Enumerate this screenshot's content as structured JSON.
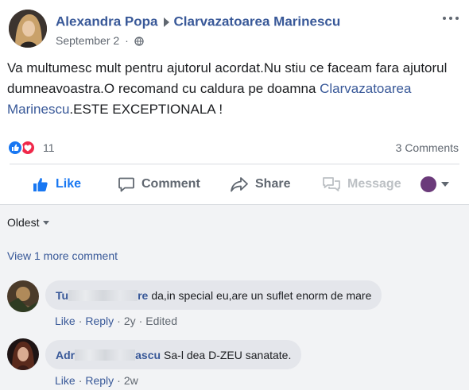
{
  "post": {
    "author": "Alexandra Popa",
    "target_page": "Clarvazatoarea Marinescu",
    "date": "September 2",
    "separator": "·",
    "text_before": "Va multumesc mult pentru ajutorul acordat.Nu stiu ce faceam fara ajutorul dumneavoastra.O recomand cu caldura pe doamna ",
    "text_mention": "Clarvazatoarea Marinescu",
    "text_after": ".ESTE EXCEPTIONALA !",
    "icons": {
      "more": "more-dots-icon",
      "audience": "globe-icon"
    }
  },
  "reactions": {
    "count": "11",
    "types": [
      "like",
      "love"
    ],
    "comments_label": "3 Comments"
  },
  "actions": {
    "like": "Like",
    "comment": "Comment",
    "share": "Share",
    "message": "Message"
  },
  "comments_section": {
    "sort_label": "Oldest",
    "view_more": "View 1 more comment",
    "comments": [
      {
        "name_start": "Tu",
        "name_end": "re",
        "text": "da,in special eu,are un suflet enorm de mare",
        "like": "Like",
        "reply": "Reply",
        "time": "2y",
        "edited": "Edited",
        "sep": "·"
      },
      {
        "name_start": "Adr",
        "name_end": "ascu",
        "text": "Sa-l dea D-ZEU sanatate.",
        "like": "Like",
        "reply": "Reply",
        "time": "2w",
        "sep": "·"
      }
    ]
  },
  "colors": {
    "link": "#385898",
    "like_blue": "#1877f2",
    "love_red": "#f0284a",
    "comments_bg": "#f2f3f5"
  }
}
